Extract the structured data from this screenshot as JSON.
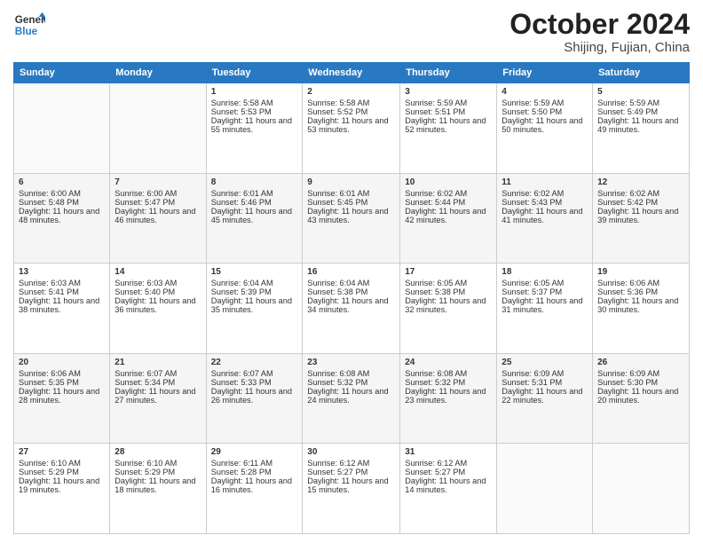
{
  "header": {
    "logo_text_line1": "General",
    "logo_text_line2": "Blue",
    "month": "October 2024",
    "location": "Shijing, Fujian, China"
  },
  "weekdays": [
    "Sunday",
    "Monday",
    "Tuesday",
    "Wednesday",
    "Thursday",
    "Friday",
    "Saturday"
  ],
  "weeks": [
    [
      {
        "day": "",
        "sunrise": "",
        "sunset": "",
        "daylight": ""
      },
      {
        "day": "",
        "sunrise": "",
        "sunset": "",
        "daylight": ""
      },
      {
        "day": "1",
        "sunrise": "Sunrise: 5:58 AM",
        "sunset": "Sunset: 5:53 PM",
        "daylight": "Daylight: 11 hours and 55 minutes."
      },
      {
        "day": "2",
        "sunrise": "Sunrise: 5:58 AM",
        "sunset": "Sunset: 5:52 PM",
        "daylight": "Daylight: 11 hours and 53 minutes."
      },
      {
        "day": "3",
        "sunrise": "Sunrise: 5:59 AM",
        "sunset": "Sunset: 5:51 PM",
        "daylight": "Daylight: 11 hours and 52 minutes."
      },
      {
        "day": "4",
        "sunrise": "Sunrise: 5:59 AM",
        "sunset": "Sunset: 5:50 PM",
        "daylight": "Daylight: 11 hours and 50 minutes."
      },
      {
        "day": "5",
        "sunrise": "Sunrise: 5:59 AM",
        "sunset": "Sunset: 5:49 PM",
        "daylight": "Daylight: 11 hours and 49 minutes."
      }
    ],
    [
      {
        "day": "6",
        "sunrise": "Sunrise: 6:00 AM",
        "sunset": "Sunset: 5:48 PM",
        "daylight": "Daylight: 11 hours and 48 minutes."
      },
      {
        "day": "7",
        "sunrise": "Sunrise: 6:00 AM",
        "sunset": "Sunset: 5:47 PM",
        "daylight": "Daylight: 11 hours and 46 minutes."
      },
      {
        "day": "8",
        "sunrise": "Sunrise: 6:01 AM",
        "sunset": "Sunset: 5:46 PM",
        "daylight": "Daylight: 11 hours and 45 minutes."
      },
      {
        "day": "9",
        "sunrise": "Sunrise: 6:01 AM",
        "sunset": "Sunset: 5:45 PM",
        "daylight": "Daylight: 11 hours and 43 minutes."
      },
      {
        "day": "10",
        "sunrise": "Sunrise: 6:02 AM",
        "sunset": "Sunset: 5:44 PM",
        "daylight": "Daylight: 11 hours and 42 minutes."
      },
      {
        "day": "11",
        "sunrise": "Sunrise: 6:02 AM",
        "sunset": "Sunset: 5:43 PM",
        "daylight": "Daylight: 11 hours and 41 minutes."
      },
      {
        "day": "12",
        "sunrise": "Sunrise: 6:02 AM",
        "sunset": "Sunset: 5:42 PM",
        "daylight": "Daylight: 11 hours and 39 minutes."
      }
    ],
    [
      {
        "day": "13",
        "sunrise": "Sunrise: 6:03 AM",
        "sunset": "Sunset: 5:41 PM",
        "daylight": "Daylight: 11 hours and 38 minutes."
      },
      {
        "day": "14",
        "sunrise": "Sunrise: 6:03 AM",
        "sunset": "Sunset: 5:40 PM",
        "daylight": "Daylight: 11 hours and 36 minutes."
      },
      {
        "day": "15",
        "sunrise": "Sunrise: 6:04 AM",
        "sunset": "Sunset: 5:39 PM",
        "daylight": "Daylight: 11 hours and 35 minutes."
      },
      {
        "day": "16",
        "sunrise": "Sunrise: 6:04 AM",
        "sunset": "Sunset: 5:38 PM",
        "daylight": "Daylight: 11 hours and 34 minutes."
      },
      {
        "day": "17",
        "sunrise": "Sunrise: 6:05 AM",
        "sunset": "Sunset: 5:38 PM",
        "daylight": "Daylight: 11 hours and 32 minutes."
      },
      {
        "day": "18",
        "sunrise": "Sunrise: 6:05 AM",
        "sunset": "Sunset: 5:37 PM",
        "daylight": "Daylight: 11 hours and 31 minutes."
      },
      {
        "day": "19",
        "sunrise": "Sunrise: 6:06 AM",
        "sunset": "Sunset: 5:36 PM",
        "daylight": "Daylight: 11 hours and 30 minutes."
      }
    ],
    [
      {
        "day": "20",
        "sunrise": "Sunrise: 6:06 AM",
        "sunset": "Sunset: 5:35 PM",
        "daylight": "Daylight: 11 hours and 28 minutes."
      },
      {
        "day": "21",
        "sunrise": "Sunrise: 6:07 AM",
        "sunset": "Sunset: 5:34 PM",
        "daylight": "Daylight: 11 hours and 27 minutes."
      },
      {
        "day": "22",
        "sunrise": "Sunrise: 6:07 AM",
        "sunset": "Sunset: 5:33 PM",
        "daylight": "Daylight: 11 hours and 26 minutes."
      },
      {
        "day": "23",
        "sunrise": "Sunrise: 6:08 AM",
        "sunset": "Sunset: 5:32 PM",
        "daylight": "Daylight: 11 hours and 24 minutes."
      },
      {
        "day": "24",
        "sunrise": "Sunrise: 6:08 AM",
        "sunset": "Sunset: 5:32 PM",
        "daylight": "Daylight: 11 hours and 23 minutes."
      },
      {
        "day": "25",
        "sunrise": "Sunrise: 6:09 AM",
        "sunset": "Sunset: 5:31 PM",
        "daylight": "Daylight: 11 hours and 22 minutes."
      },
      {
        "day": "26",
        "sunrise": "Sunrise: 6:09 AM",
        "sunset": "Sunset: 5:30 PM",
        "daylight": "Daylight: 11 hours and 20 minutes."
      }
    ],
    [
      {
        "day": "27",
        "sunrise": "Sunrise: 6:10 AM",
        "sunset": "Sunset: 5:29 PM",
        "daylight": "Daylight: 11 hours and 19 minutes."
      },
      {
        "day": "28",
        "sunrise": "Sunrise: 6:10 AM",
        "sunset": "Sunset: 5:29 PM",
        "daylight": "Daylight: 11 hours and 18 minutes."
      },
      {
        "day": "29",
        "sunrise": "Sunrise: 6:11 AM",
        "sunset": "Sunset: 5:28 PM",
        "daylight": "Daylight: 11 hours and 16 minutes."
      },
      {
        "day": "30",
        "sunrise": "Sunrise: 6:12 AM",
        "sunset": "Sunset: 5:27 PM",
        "daylight": "Daylight: 11 hours and 15 minutes."
      },
      {
        "day": "31",
        "sunrise": "Sunrise: 6:12 AM",
        "sunset": "Sunset: 5:27 PM",
        "daylight": "Daylight: 11 hours and 14 minutes."
      },
      {
        "day": "",
        "sunrise": "",
        "sunset": "",
        "daylight": ""
      },
      {
        "day": "",
        "sunrise": "",
        "sunset": "",
        "daylight": ""
      }
    ]
  ]
}
